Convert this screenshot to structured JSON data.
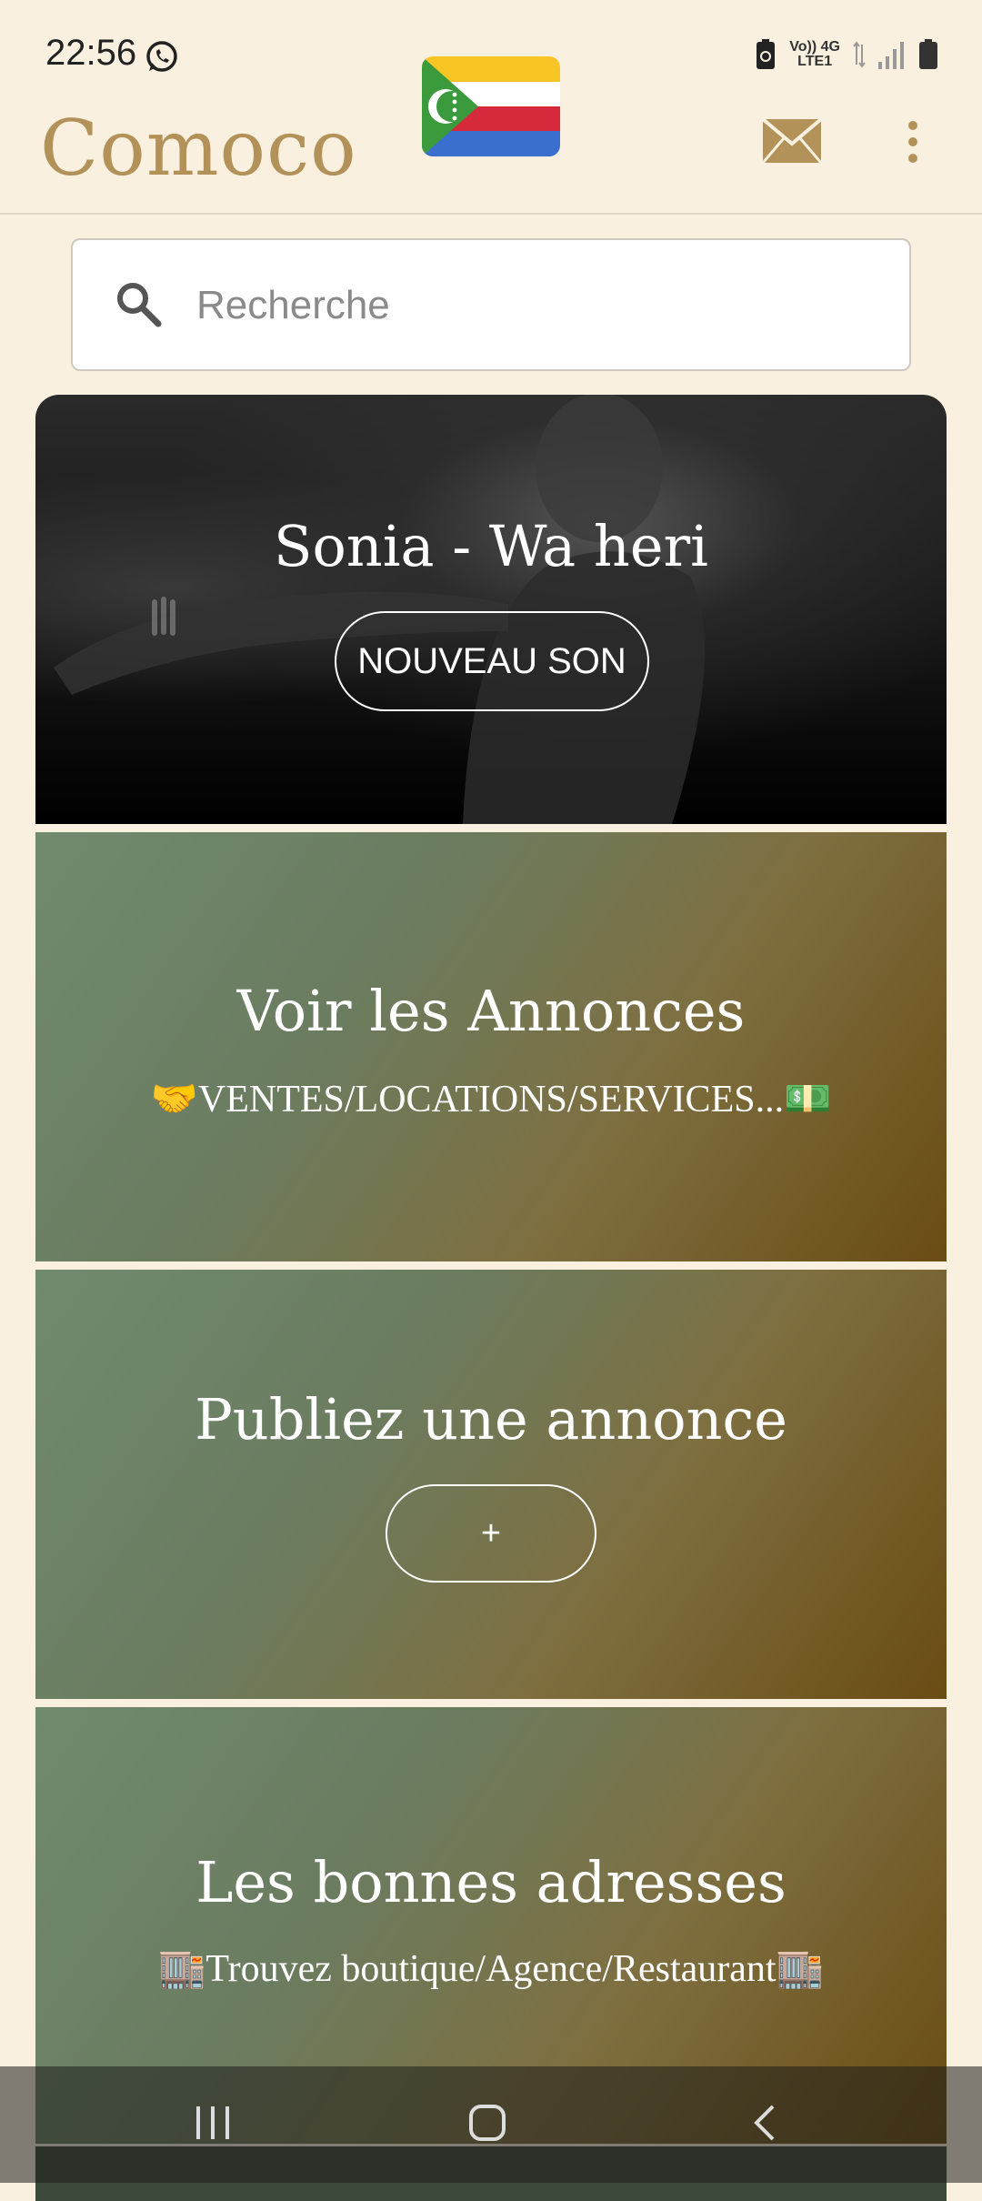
{
  "status_bar": {
    "time": "22:56",
    "network_top": "Vo)) 4G",
    "network_bottom": "LTE1"
  },
  "header": {
    "app_title": "Comoco",
    "flag_colors": [
      "#f7c624",
      "#ffffff",
      "#d62a3c",
      "#3a6fcf",
      "#3b9a3c"
    ]
  },
  "search": {
    "placeholder": "Recherche"
  },
  "hero_card": {
    "title": "Sonia - Wa heri",
    "button_label": "NOUVEAU SON"
  },
  "ads_card": {
    "title": "Voir les Annonces",
    "subtitle_left_emoji": "🤝",
    "subtitle": "VENTES/LOCATIONS/SERVICES...",
    "subtitle_right_emoji": "💵"
  },
  "publish_card": {
    "title": "Publiez une annonce",
    "button_label": "+"
  },
  "addresses_card": {
    "title": "Les bonnes adresses",
    "subtitle_left_emoji": "🏬",
    "subtitle": "Trouvez boutique/Agence/Restaurant",
    "subtitle_right_emoji": "🏬"
  },
  "colors": {
    "brand": "#b3925a",
    "background": "#faf0df"
  }
}
